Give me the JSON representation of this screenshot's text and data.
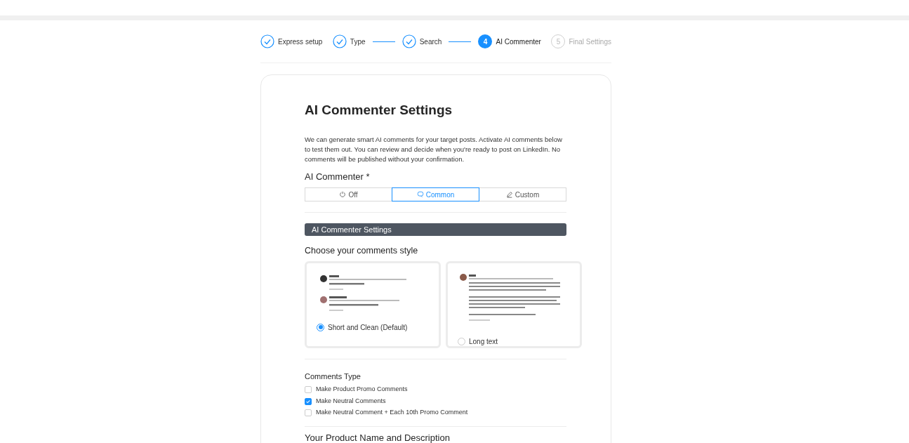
{
  "steps": [
    {
      "label": "Express setup",
      "completed": true,
      "active": false,
      "line_after": false
    },
    {
      "label": "Type",
      "completed": true,
      "active": false,
      "line_after": true
    },
    {
      "label": "Search",
      "completed": true,
      "active": false,
      "line_after": true
    },
    {
      "label": "AI Commenter",
      "completed": false,
      "active": true,
      "number": "4",
      "line_after": false
    },
    {
      "label": "Final Settings",
      "completed": false,
      "active": false,
      "number": "5",
      "line_after": false
    }
  ],
  "title": "AI Commenter Settings",
  "intro": "We can generate smart AI comments for your target posts. Activate AI comments below to test them out. You can review and decide when you're ready to post on LinkedIn. No comments will be published without your confirmation.",
  "mode_label": "AI Commenter *",
  "modes": [
    {
      "label": "Off",
      "kind": "power",
      "selected": false
    },
    {
      "label": "Common",
      "kind": "chat",
      "selected": true
    },
    {
      "label": "Custom",
      "kind": "pen",
      "selected": false
    }
  ],
  "section_header": "AI Commenter Settings",
  "style_label": "Choose your comments style",
  "styles": [
    {
      "label": "Short and Clean (Default)",
      "kind": "short",
      "selected": true
    },
    {
      "label": "Long text",
      "kind": "long",
      "selected": false
    }
  ],
  "comments_type_label": "Comments Type",
  "comment_types": [
    {
      "label": "Make Product Promo Comments",
      "checked": false
    },
    {
      "label": "Make Neutral Comments",
      "checked": true
    },
    {
      "label": "Make Neutral Comment + Each 10th Promo Comment",
      "checked": false
    }
  ],
  "next_label": "Your Product Name and Description"
}
